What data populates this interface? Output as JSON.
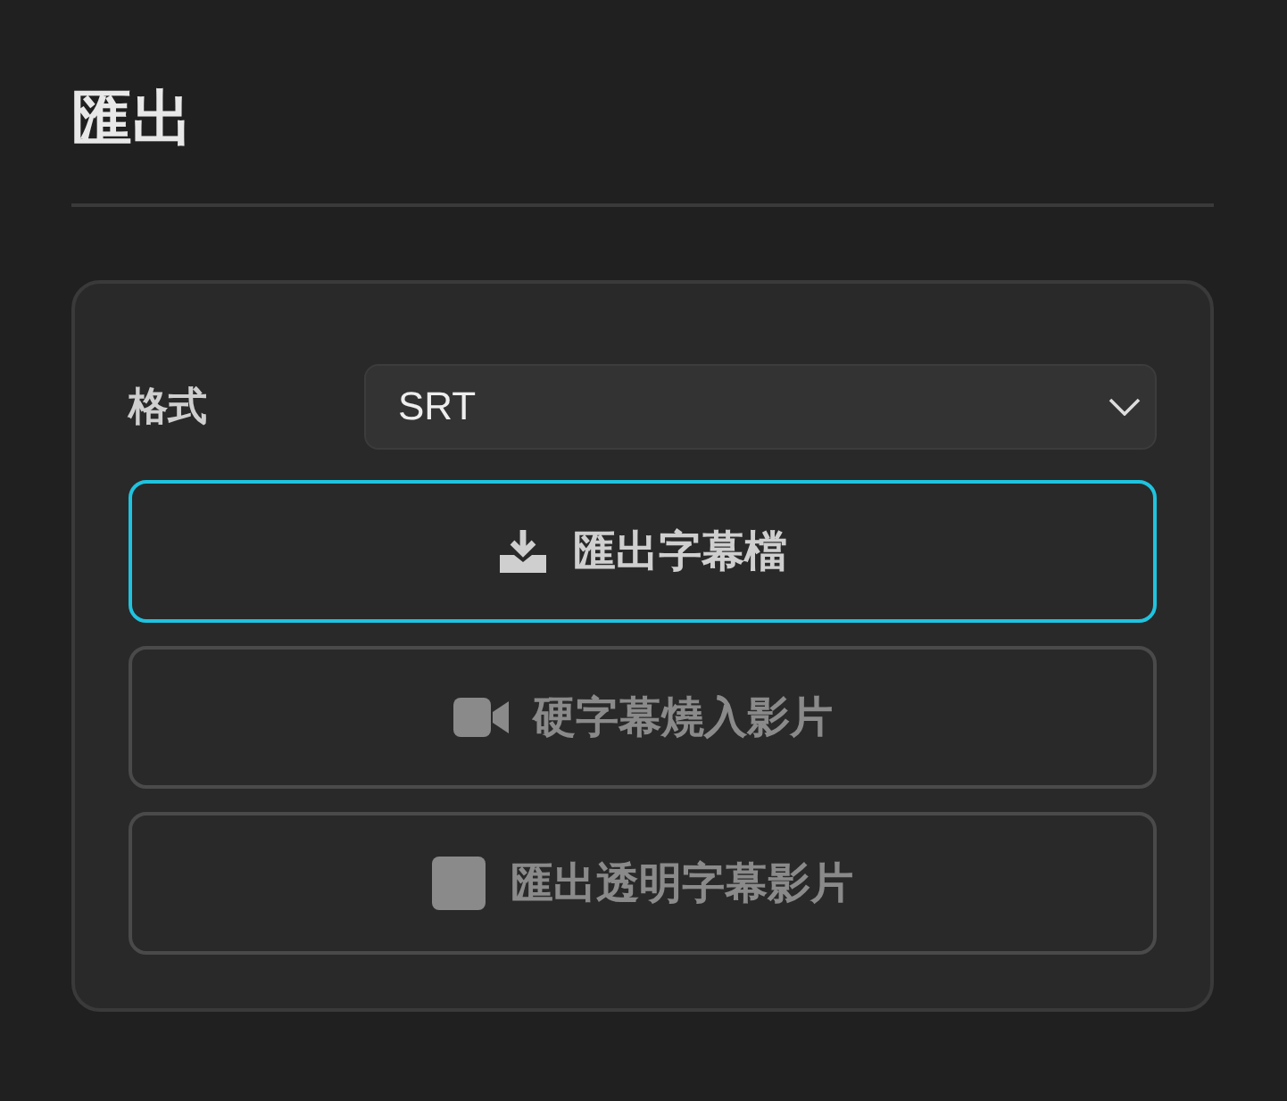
{
  "title": "匯出",
  "format": {
    "label": "格式",
    "value": "SRT"
  },
  "buttons": [
    {
      "label": "匯出字幕檔",
      "kind": "download",
      "focused": true,
      "disabled": false
    },
    {
      "label": "硬字幕燒入影片",
      "kind": "video",
      "focused": false,
      "disabled": true
    },
    {
      "label": "匯出透明字幕影片",
      "kind": "square",
      "focused": false,
      "disabled": true
    }
  ]
}
